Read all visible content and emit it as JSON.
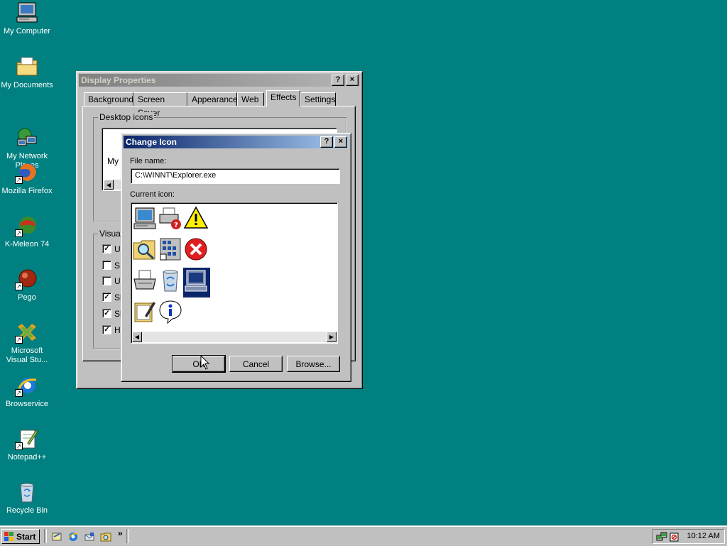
{
  "desktop": {
    "icons": [
      {
        "label": "My Computer",
        "icon": "my-computer-icon"
      },
      {
        "label": "My Documents",
        "icon": "my-documents-icon"
      },
      {
        "label": "My Network\nPlaces",
        "icon": "network-places-icon"
      },
      {
        "label": "Mozilla Firefox",
        "icon": "firefox-icon"
      },
      {
        "label": "K-Meleon 74",
        "icon": "k-meleon-icon"
      },
      {
        "label": "Pego",
        "icon": "pego-icon"
      },
      {
        "label": "Microsoft\nVisual Stu...",
        "icon": "visual-studio-icon"
      },
      {
        "label": "Browservice",
        "icon": "internet-explorer-icon"
      },
      {
        "label": "Notepad++",
        "icon": "notepadpp-icon"
      },
      {
        "label": "Recycle Bin",
        "icon": "recycle-bin-icon"
      }
    ]
  },
  "display_properties": {
    "title": "Display Properties",
    "help_btn": "?",
    "close_btn": "×",
    "tabs": [
      "Background",
      "Screen Saver",
      "Appearance",
      "Web",
      "Effects",
      "Settings"
    ],
    "selected_tab": "Effects",
    "desktop_icons_label": "Desktop icons",
    "partial_icon_label": "My",
    "visual_effects_label": "Visual",
    "checkboxes": [
      {
        "label": "U",
        "checked": true
      },
      {
        "label": "S",
        "checked": false
      },
      {
        "label": "U",
        "checked": false
      },
      {
        "label": "Sl",
        "checked": true
      },
      {
        "label": "Sl",
        "checked": true
      },
      {
        "label": "H",
        "checked": true
      }
    ]
  },
  "change_icon": {
    "title": "Change Icon",
    "help_btn": "?",
    "close_btn": "×",
    "file_name_label": "File name:",
    "file_name_value": "C:\\WINNT\\Explorer.exe",
    "current_icon_label": "Current icon:",
    "icons": [
      {
        "name": "computer-icon"
      },
      {
        "name": "printer-question-icon"
      },
      {
        "name": "warning-icon"
      },
      {
        "name": "search-folder-icon"
      },
      {
        "name": "network-grid-icon"
      },
      {
        "name": "error-icon"
      },
      {
        "name": "printer-icon"
      },
      {
        "name": "recycle-bin-icon"
      },
      {
        "name": "computer-selected-icon"
      },
      {
        "name": "notepad-icon"
      },
      {
        "name": "info-icon"
      }
    ],
    "selected_icon": "computer-selected-icon",
    "ok_label": "OK",
    "cancel_label": "Cancel",
    "browse_label": "Browse..."
  },
  "taskbar": {
    "start_label": "Start",
    "quick_launch": [
      "show-desktop-icon",
      "ie-icon",
      "outlook-icon",
      "explorer-icon"
    ],
    "chevron": "»",
    "clock": "10:12 AM",
    "tray_icons": [
      "network-tray-icon",
      "speaker-tray-icon"
    ]
  },
  "colors": {
    "desktop": "#008080",
    "active_title": "#0a246a",
    "inactive_title": "#808080"
  }
}
